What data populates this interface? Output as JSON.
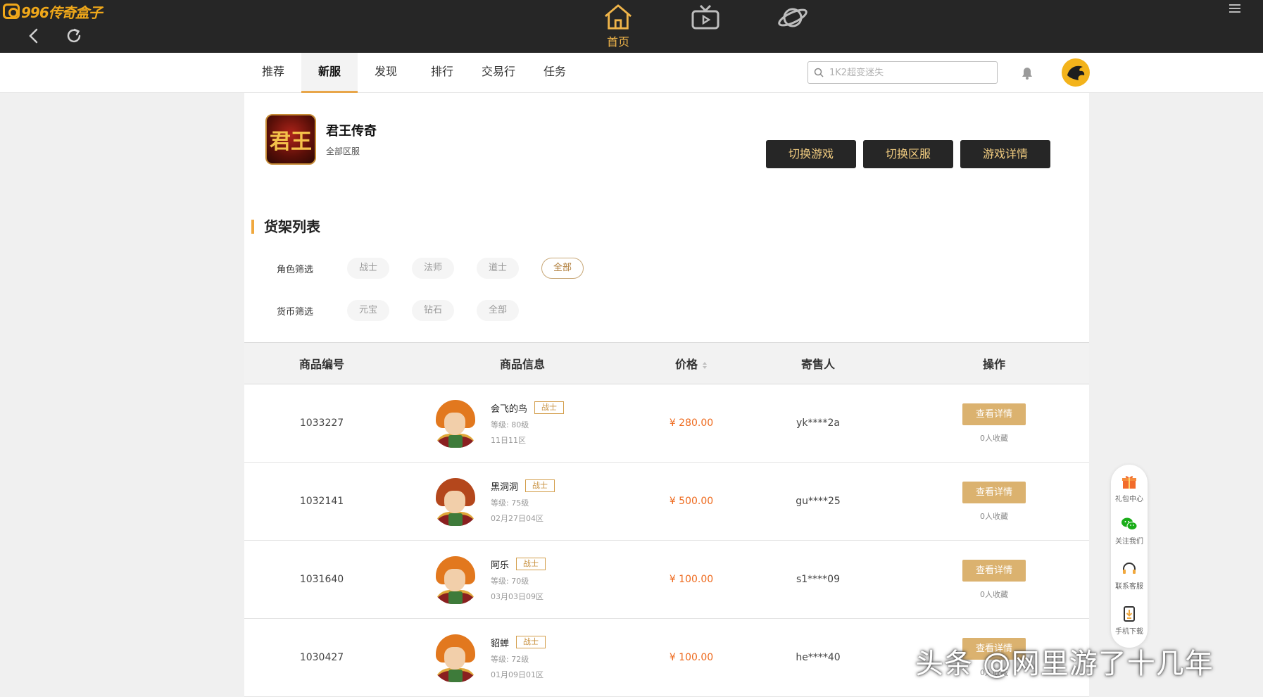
{
  "app": {
    "logo_text": "996传奇盒子"
  },
  "topbar": {
    "home_label": "首页"
  },
  "tabs": [
    {
      "label": "推荐"
    },
    {
      "label": "新服"
    },
    {
      "label": "发现"
    },
    {
      "label": "排行"
    },
    {
      "label": "交易行"
    },
    {
      "label": "任务"
    }
  ],
  "search": {
    "placeholder": "1K2超变迷失"
  },
  "game": {
    "icon_text": "君王",
    "name": "君王传奇",
    "sub": "全部区服",
    "buttons": {
      "switch_game": "切换游戏",
      "switch_server": "切换区服",
      "game_detail": "游戏详情"
    }
  },
  "shelf": {
    "title": "货架列表",
    "role_filter": {
      "label": "角色筛选",
      "options": [
        "战士",
        "法师",
        "道士",
        "全部"
      ],
      "selected": "全部"
    },
    "currency_filter": {
      "label": "货币筛选",
      "options": [
        "元宝",
        "钻石",
        "全部"
      ]
    }
  },
  "table": {
    "headers": {
      "id": "商品编号",
      "info": "商品信息",
      "price": "价格",
      "seller": "寄售人",
      "action": "操作"
    },
    "detail_label": "查看详情",
    "rows": [
      {
        "id": "1033227",
        "name": "会飞的鸟",
        "tag": "战士",
        "level": "等级: 80级",
        "server": "11日11区",
        "price": "¥ 280.00",
        "seller": "yk****2a",
        "fav": "0人收藏"
      },
      {
        "id": "1032141",
        "name": "黑洞洞",
        "tag": "战士",
        "level": "等级: 75级",
        "server": "02月27日04区",
        "price": "¥ 500.00",
        "seller": "gu****25",
        "fav": "0人收藏"
      },
      {
        "id": "1031640",
        "name": "阿乐",
        "tag": "战士",
        "level": "等级: 70级",
        "server": "03月03日09区",
        "price": "¥ 100.00",
        "seller": "s1****09",
        "fav": "0人收藏"
      },
      {
        "id": "1030427",
        "name": "貂蝉",
        "tag": "战士",
        "level": "等级: 72级",
        "server": "01月09日01区",
        "price": "¥ 100.00",
        "seller": "he****40",
        "fav": "0人收藏"
      }
    ]
  },
  "sidebar": [
    {
      "label": "礼包中心"
    },
    {
      "label": "关注我们"
    },
    {
      "label": "联系客服"
    },
    {
      "label": "手机下载"
    }
  ],
  "watermark": "头条 @网里游了十几年"
}
